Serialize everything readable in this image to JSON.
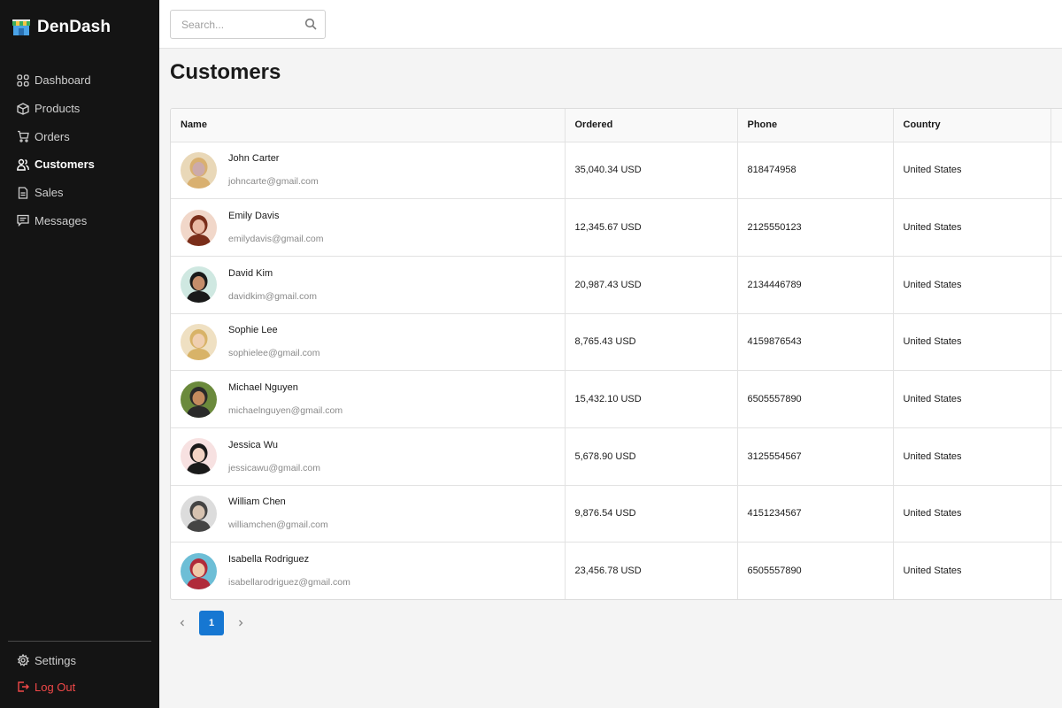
{
  "brand": {
    "name": "DenDash"
  },
  "sidebar": {
    "items": [
      {
        "label": "Dashboard",
        "icon": "grid-icon",
        "active": false
      },
      {
        "label": "Products",
        "icon": "box-icon",
        "active": false
      },
      {
        "label": "Orders",
        "icon": "cart-icon",
        "active": false
      },
      {
        "label": "Customers",
        "icon": "users-icon",
        "active": true
      },
      {
        "label": "Sales",
        "icon": "document-icon",
        "active": false
      },
      {
        "label": "Messages",
        "icon": "message-icon",
        "active": false
      }
    ],
    "settings_label": "Settings",
    "logout_label": "Log Out"
  },
  "search": {
    "placeholder": "Search..."
  },
  "page": {
    "title": "Customers"
  },
  "table": {
    "columns": [
      "Name",
      "Ordered",
      "Phone",
      "Country"
    ],
    "rows": [
      {
        "name": "John Carter",
        "email": "johncarte@gmail.com",
        "ordered": "35,040.34 USD",
        "phone": "818474958",
        "country": "United States"
      },
      {
        "name": "Emily Davis",
        "email": "emilydavis@gmail.com",
        "ordered": "12,345.67 USD",
        "phone": "2125550123",
        "country": "United States"
      },
      {
        "name": "David Kim",
        "email": "davidkim@gmail.com",
        "ordered": "20,987.43 USD",
        "phone": "2134446789",
        "country": "United States"
      },
      {
        "name": "Sophie Lee",
        "email": "sophielee@gmail.com",
        "ordered": "8,765.43 USD",
        "phone": "4159876543",
        "country": "United States"
      },
      {
        "name": "Michael Nguyen",
        "email": "michaelnguyen@gmail.com",
        "ordered": "15,432.10 USD",
        "phone": "6505557890",
        "country": "United States"
      },
      {
        "name": "Jessica Wu",
        "email": "jessicawu@gmail.com",
        "ordered": "5,678.90 USD",
        "phone": "3125554567",
        "country": "United States"
      },
      {
        "name": "William Chen",
        "email": "williamchen@gmail.com",
        "ordered": "9,876.54 USD",
        "phone": "4151234567",
        "country": "United States"
      },
      {
        "name": "Isabella Rodriguez",
        "email": "isabellarodriguez@gmail.com",
        "ordered": "23,456.78 USD",
        "phone": "6505557890",
        "country": "United States"
      }
    ]
  },
  "pagination": {
    "current": "1",
    "prev_icon": "chevron-left-icon",
    "next_icon": "chevron-right-icon"
  },
  "colors": {
    "sidebar_bg": "#141414",
    "accent": "#1677d2",
    "logout": "#f04848"
  }
}
